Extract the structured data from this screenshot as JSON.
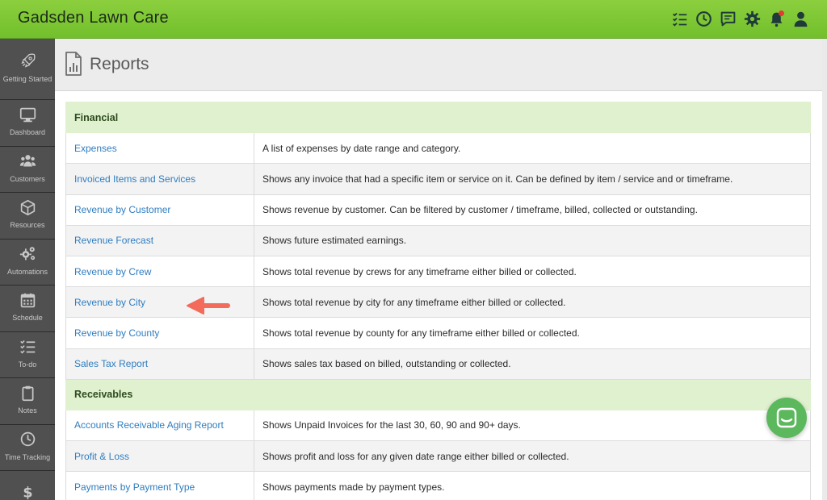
{
  "app": {
    "brand": "Gadsden Lawn Care"
  },
  "topbar": {
    "icons": [
      "checklist-icon",
      "clock-icon",
      "chat-icon",
      "gear-icon",
      "bell-icon",
      "user-icon"
    ]
  },
  "sidebar": {
    "items": [
      {
        "label": "Getting Started",
        "icon": "rocket-icon"
      },
      {
        "label": "Dashboard",
        "icon": "monitor-icon"
      },
      {
        "label": "Customers",
        "icon": "users-icon"
      },
      {
        "label": "Resources",
        "icon": "cube-icon"
      },
      {
        "label": "Automations",
        "icon": "gears-icon"
      },
      {
        "label": "Schedule",
        "icon": "calendar-icon"
      },
      {
        "label": "To-do",
        "icon": "checklist-icon"
      },
      {
        "label": "Notes",
        "icon": "clipboard-icon"
      },
      {
        "label": "Time Tracking",
        "icon": "clock-icon"
      },
      {
        "label": "",
        "icon": "dollar-icon"
      }
    ]
  },
  "page": {
    "title": "Reports"
  },
  "sections": {
    "financial": {
      "title": "Financial",
      "rows": [
        {
          "name": "Expenses",
          "description": "A list of expenses by date range and category."
        },
        {
          "name": "Invoiced Items and Services",
          "description": "Shows any invoice that had a specific item or service on it. Can be defined by item / service and or timeframe."
        },
        {
          "name": "Revenue by Customer",
          "description": "Shows revenue by customer. Can be filtered by customer / timeframe, billed, collected or outstanding."
        },
        {
          "name": "Revenue Forecast",
          "description": "Shows future estimated earnings."
        },
        {
          "name": "Revenue by Crew",
          "description": "Shows total revenue by crews for any timeframe either billed or collected."
        },
        {
          "name": "Revenue by City",
          "description": "Shows total revenue by city for any timeframe either billed or collected."
        },
        {
          "name": "Revenue by County",
          "description": "Shows total revenue by county for any timeframe either billed or collected."
        },
        {
          "name": "Sales Tax Report",
          "description": "Shows sales tax based on billed, outstanding or collected."
        }
      ]
    },
    "receivables": {
      "title": "Receivables",
      "rows": [
        {
          "name": "Accounts Receivable Aging Report",
          "description": "Shows Unpaid Invoices for the last 30, 60, 90 and 90+ days."
        },
        {
          "name": "Profit & Loss",
          "description": "Shows profit and loss for any given date range either billed or collected."
        },
        {
          "name": "Payments by Payment Type",
          "description": "Shows payments made by payment types."
        }
      ]
    }
  },
  "colors": {
    "topbar": "#7ac536",
    "sidebar": "#505050",
    "section_header_bg": "#dff1cf",
    "link": "#2f7dc0",
    "annotation_arrow": "#f26b5b",
    "chat_button": "#5cb85c"
  }
}
